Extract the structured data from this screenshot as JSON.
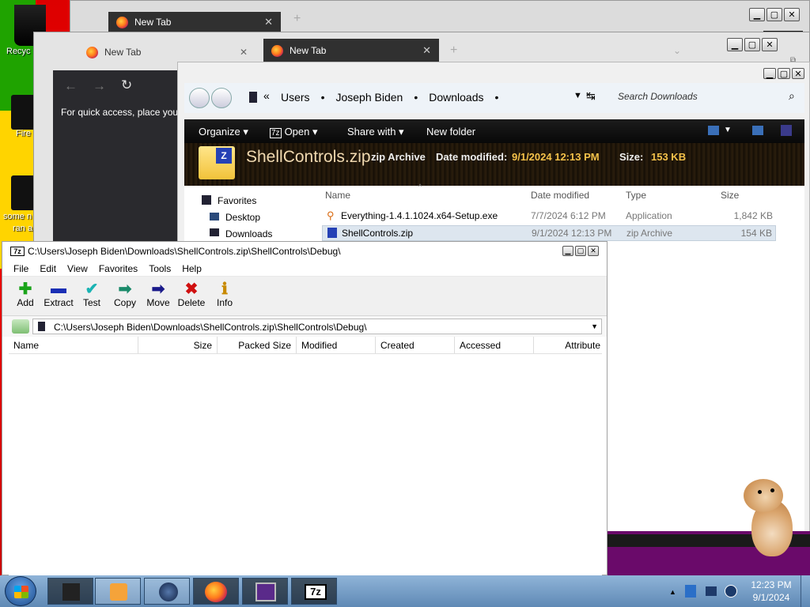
{
  "desktop": {
    "icons": [
      {
        "label": "Recyc"
      },
      {
        "label": "Fire"
      },
      {
        "label": "some n",
        "label2": "ran a"
      }
    ]
  },
  "browser_back": {
    "tab_title": "New Tab",
    "close": "✕",
    "new_tab": "+"
  },
  "browser_mid": {
    "tab1_title": "New Tab",
    "tab2_title": "New Tab",
    "close": "✕",
    "new_tab": "+",
    "quick_access_text": "For quick access, place your"
  },
  "explorer": {
    "breadcrumb": [
      "Users",
      "Joseph Biden",
      "Downloads"
    ],
    "search_placeholder": "Search Downloads",
    "toolbar": {
      "organize": "Organize",
      "open": "Open",
      "share": "Share with",
      "new_folder": "New folder"
    },
    "preview": {
      "name": "ShellControls.zip",
      "type": "zip Archive",
      "date_label": "Date modified:",
      "date": "9/1/2024 12:13 PM",
      "size_label": "Size:",
      "size": "153 KB"
    },
    "nav": {
      "favorites": "Favorites",
      "desktop": "Desktop",
      "downloads": "Downloads"
    },
    "columns": {
      "name": "Name",
      "date": "Date modified",
      "type": "Type",
      "size": "Size"
    },
    "files": [
      {
        "name": "Everything-1.4.1.1024.x64-Setup.exe",
        "date": "7/7/2024 6:12 PM",
        "type": "Application",
        "size": "1,842 KB"
      },
      {
        "name": "ShellControls.zip",
        "date": "9/1/2024 12:13 PM",
        "type": "zip Archive",
        "size": "154 KB"
      }
    ]
  },
  "sevenzip": {
    "title": "C:\\Users\\Joseph Biden\\Downloads\\ShellControls.zip\\ShellControls\\Debug\\",
    "app_icon": "7z",
    "menu": [
      "File",
      "Edit",
      "View",
      "Favorites",
      "Tools",
      "Help"
    ],
    "tools": [
      {
        "label": "Add",
        "icon": "add-icon",
        "glyph": "✚",
        "color": "#1aa31a"
      },
      {
        "label": "Extract",
        "icon": "extract-icon",
        "glyph": "▬",
        "color": "#1a2fb5"
      },
      {
        "label": "Test",
        "icon": "test-icon",
        "glyph": "✔",
        "color": "#1ab3b3"
      },
      {
        "label": "Copy",
        "icon": "copy-icon",
        "glyph": "➡",
        "color": "#1a8a6a"
      },
      {
        "label": "Move",
        "icon": "move-icon",
        "glyph": "➡",
        "color": "#1a1a8a"
      },
      {
        "label": "Delete",
        "icon": "delete-icon",
        "glyph": "✖",
        "color": "#d01010"
      },
      {
        "label": "Info",
        "icon": "info-icon",
        "glyph": "ℹ",
        "color": "#c88a00"
      }
    ],
    "address": "C:\\Users\\Joseph Biden\\Downloads\\ShellControls.zip\\ShellControls\\Debug\\",
    "columns": [
      "Name",
      "Size",
      "Packed Size",
      "Modified",
      "Created",
      "Accessed",
      "Attribute"
    ]
  },
  "taskbar": {
    "time": "12:23 PM",
    "date": "9/1/2024",
    "sevenzip_button": "7z"
  }
}
